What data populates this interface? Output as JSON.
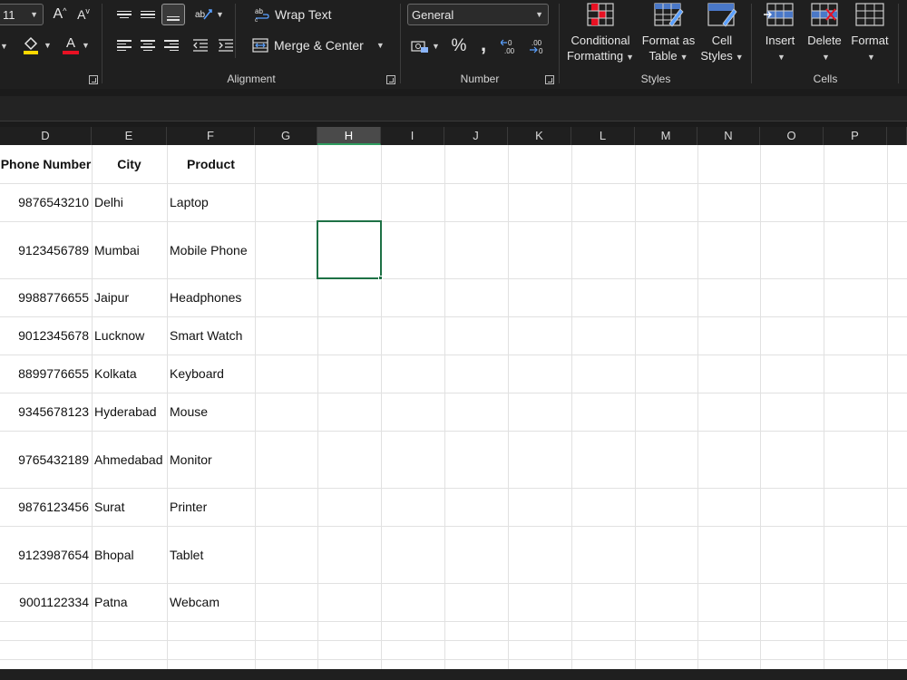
{
  "ribbon": {
    "font": {
      "size": "11",
      "grow_label": "A",
      "shrink_label": "A",
      "font_color_label": "A"
    },
    "alignment": {
      "group_label": "Alignment",
      "wrap_text": "Wrap Text",
      "merge_center": "Merge & Center"
    },
    "number": {
      "group_label": "Number",
      "format": "General",
      "percent": "%",
      "comma": ",",
      "inc_decimal": ".00",
      "dec_decimal": ".00"
    },
    "styles": {
      "group_label": "Styles",
      "conditional": [
        "Conditional",
        "Formatting"
      ],
      "format_table": [
        "Format as",
        "Table"
      ],
      "cell_styles": [
        "Cell",
        "Styles"
      ]
    },
    "cells": {
      "group_label": "Cells",
      "insert": "Insert",
      "delete": "Delete",
      "format": "Format"
    }
  },
  "grid": {
    "columns": [
      "D",
      "E",
      "F",
      "G",
      "H",
      "I",
      "J",
      "K",
      "L",
      "M",
      "N",
      "O",
      "P"
    ],
    "selected_column": "H",
    "headers": [
      "Phone Number",
      "City",
      "Product"
    ],
    "rows": [
      [
        "9876543210",
        "Delhi",
        "Laptop"
      ],
      [
        "9123456789",
        "Mumbai",
        "Mobile Phone"
      ],
      [
        "9988776655",
        "Jaipur",
        "Headphones"
      ],
      [
        "9012345678",
        "Lucknow",
        "Smart Watch"
      ],
      [
        "8899776655",
        "Kolkata",
        "Keyboard"
      ],
      [
        "9345678123",
        "Hyderabad",
        "Mouse"
      ],
      [
        "9765432189",
        "Ahmedabad",
        "Monitor"
      ],
      [
        "9876123456",
        "Surat",
        "Printer"
      ],
      [
        "9123987654",
        "Bhopal",
        "Tablet"
      ],
      [
        "9001122334",
        "Patna",
        "Webcam"
      ]
    ]
  },
  "colors": {
    "accent": "#1e7145",
    "ribbon_bg": "#1f1f1f",
    "red_underline": "#e81123",
    "yellow_underline": "#ffd800"
  }
}
